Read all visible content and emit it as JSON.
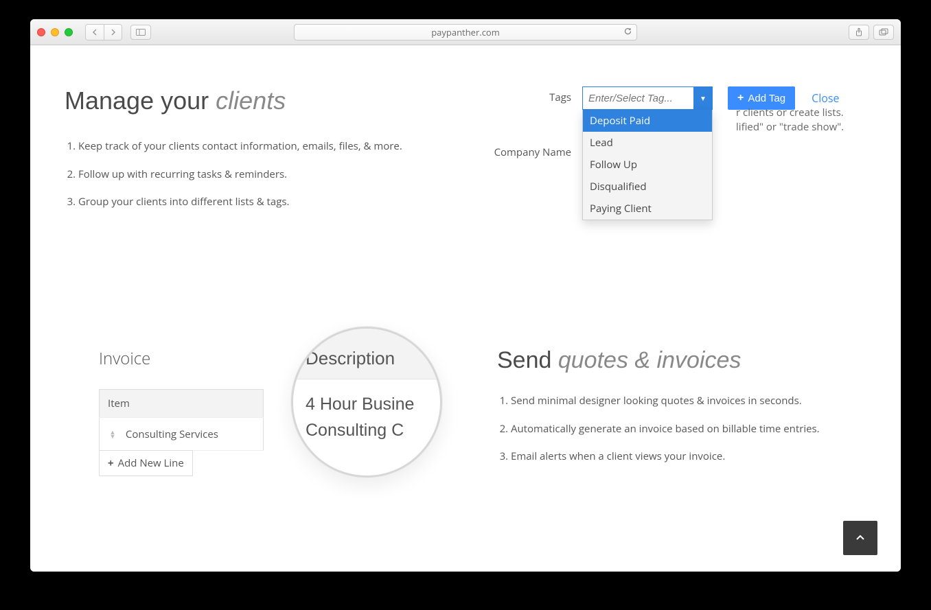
{
  "browser": {
    "url": "paypanther.com"
  },
  "section1": {
    "heading_plain": "Manage your",
    "heading_em": "clients",
    "bullets": [
      "Keep track of your clients contact information, emails, files, & more.",
      "Follow up with recurring tasks & reminders.",
      "Group your clients into different lists & tags."
    ]
  },
  "tags": {
    "label": "Tags",
    "placeholder": "Enter/Select Tag...",
    "add_button": "Add Tag",
    "close": "Close",
    "hint_line1": "r clients or create lists.",
    "hint_line2": "lified\" or \"trade show\".",
    "options": [
      "Deposit Paid",
      "Lead",
      "Follow Up",
      "Disqualified",
      "Paying Client"
    ],
    "company_label": "Company Name"
  },
  "invoice": {
    "title": "Invoice",
    "col_item": "Item",
    "row_item": "Consulting Services",
    "add_line": "Add New Line",
    "magnifier": {
      "header": "Description",
      "line1": "4 Hour Busine",
      "line2": "Consulting C"
    }
  },
  "section2": {
    "heading_plain": "Send",
    "heading_em": "quotes & invoices",
    "bullets": [
      "Send minimal designer looking quotes & invoices in seconds.",
      "Automatically generate an invoice based on billable time entries.",
      "Email alerts when a client views your invoice."
    ]
  }
}
